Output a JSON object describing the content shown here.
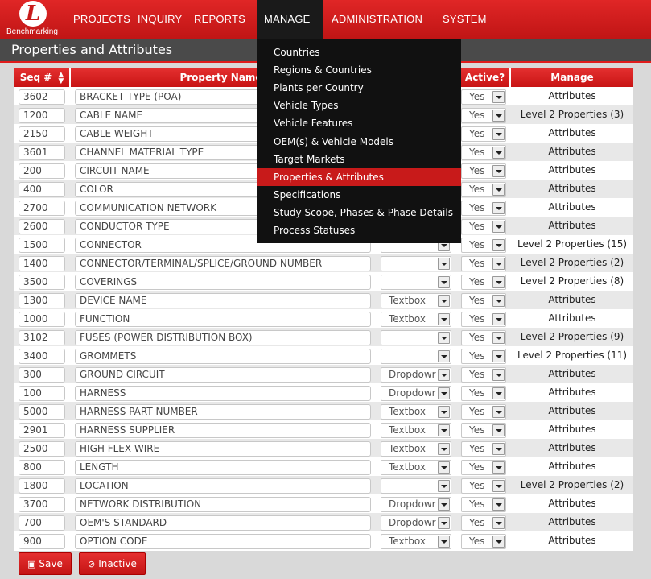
{
  "brand": {
    "mark": "L",
    "name": "Benchmarking"
  },
  "nav": {
    "items": [
      {
        "label": "PROJECTS",
        "caret": false
      },
      {
        "label": "INQUIRY",
        "caret": false
      },
      {
        "label": "REPORTS",
        "caret": true
      },
      {
        "label": "MANAGE",
        "caret": true,
        "active": true
      },
      {
        "label": "ADMINISTRATION",
        "caret": true
      },
      {
        "label": "SYSTEM",
        "caret": true
      }
    ]
  },
  "page_title": "Properties and Attributes",
  "table": {
    "headers": {
      "seq": "Seq #",
      "name": "Property Name",
      "active": "Active?",
      "manage": "Manage"
    },
    "rows": [
      {
        "seq": "3602",
        "name": "BRACKET TYPE (POA)",
        "type": "",
        "active": "Yes",
        "manage": "Attributes"
      },
      {
        "seq": "1200",
        "name": "CABLE NAME",
        "type": "",
        "active": "Yes",
        "manage": "Level 2 Properties (3)"
      },
      {
        "seq": "2150",
        "name": "CABLE WEIGHT",
        "type": "",
        "active": "Yes",
        "manage": "Attributes"
      },
      {
        "seq": "3601",
        "name": "CHANNEL MATERIAL TYPE",
        "type": "",
        "active": "Yes",
        "manage": "Attributes"
      },
      {
        "seq": "200",
        "name": "CIRCUIT NAME",
        "type": "",
        "active": "Yes",
        "manage": "Attributes"
      },
      {
        "seq": "400",
        "name": "COLOR",
        "type": "",
        "active": "Yes",
        "manage": "Attributes"
      },
      {
        "seq": "2700",
        "name": "COMMUNICATION NETWORK",
        "type": "",
        "active": "Yes",
        "manage": "Attributes"
      },
      {
        "seq": "2600",
        "name": "CONDUCTOR TYPE",
        "type": "",
        "active": "Yes",
        "manage": "Attributes"
      },
      {
        "seq": "1500",
        "name": "CONNECTOR",
        "type": "",
        "active": "Yes",
        "manage": "Level 2 Properties (15)"
      },
      {
        "seq": "1400",
        "name": "CONNECTOR/TERMINAL/SPLICE/GROUND NUMBER",
        "type": "",
        "active": "Yes",
        "manage": "Level 2 Properties (2)"
      },
      {
        "seq": "3500",
        "name": "COVERINGS",
        "type": "",
        "active": "Yes",
        "manage": "Level 2 Properties (8)"
      },
      {
        "seq": "1300",
        "name": "DEVICE NAME",
        "type": "Textbox",
        "active": "Yes",
        "manage": "Attributes"
      },
      {
        "seq": "1000",
        "name": "FUNCTION",
        "type": "Textbox",
        "active": "Yes",
        "manage": "Attributes"
      },
      {
        "seq": "3102",
        "name": "FUSES (POWER DISTRIBUTION BOX)",
        "type": "",
        "active": "Yes",
        "manage": "Level 2 Properties (9)"
      },
      {
        "seq": "3400",
        "name": "GROMMETS",
        "type": "",
        "active": "Yes",
        "manage": "Level 2 Properties (11)"
      },
      {
        "seq": "300",
        "name": "GROUND CIRCUIT",
        "type": "Dropdowr",
        "active": "Yes",
        "manage": "Attributes"
      },
      {
        "seq": "100",
        "name": "HARNESS",
        "type": "Dropdowr",
        "active": "Yes",
        "manage": "Attributes"
      },
      {
        "seq": "5000",
        "name": "HARNESS PART NUMBER",
        "type": "Textbox",
        "active": "Yes",
        "manage": "Attributes"
      },
      {
        "seq": "2901",
        "name": "HARNESS SUPPLIER",
        "type": "Textbox",
        "active": "Yes",
        "manage": "Attributes"
      },
      {
        "seq": "2500",
        "name": "HIGH FLEX WIRE",
        "type": "Textbox",
        "active": "Yes",
        "manage": "Attributes"
      },
      {
        "seq": "800",
        "name": "LENGTH",
        "type": "Textbox",
        "active": "Yes",
        "manage": "Attributes"
      },
      {
        "seq": "1800",
        "name": "LOCATION",
        "type": "",
        "active": "Yes",
        "manage": "Level 2 Properties (2)"
      },
      {
        "seq": "3700",
        "name": "NETWORK DISTRIBUTION",
        "type": "Dropdowr",
        "active": "Yes",
        "manage": "Attributes"
      },
      {
        "seq": "700",
        "name": "OEM'S STANDARD",
        "type": "Dropdowr",
        "active": "Yes",
        "manage": "Attributes"
      },
      {
        "seq": "900",
        "name": "OPTION CODE",
        "type": "Textbox",
        "active": "Yes",
        "manage": "Attributes"
      }
    ]
  },
  "buttons": {
    "save": "Save",
    "inactive": "Inactive"
  },
  "manage_menu": {
    "items": [
      "Countries",
      "Regions & Countries",
      "Plants per Country",
      "Vehicle Types",
      "Vehicle Features",
      "OEM(s) & Vehicle Models",
      "Target Markets",
      "Properties & Attributes",
      "Specifications",
      "Study Scope, Phases & Phase Details",
      "Process Statuses"
    ],
    "highlighted": "Properties & Attributes"
  },
  "colors": {
    "accent": "#c81a1a",
    "nav_bg": "#d41e1e",
    "menu_bg": "#111111",
    "title_bg": "#4a4a4a"
  },
  "icons": {
    "save": "floppy-disk-icon",
    "inactive": "ban-icon",
    "sort": "sort-icon",
    "caret": "caret-down-icon"
  }
}
